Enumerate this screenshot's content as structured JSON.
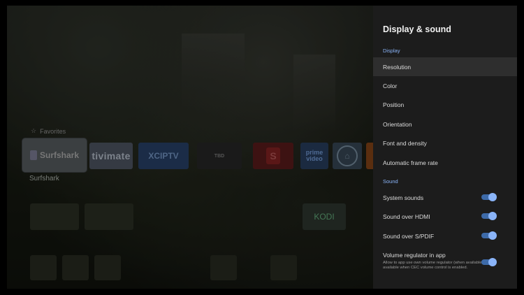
{
  "home": {
    "favorites_label": "Favorites",
    "apps": [
      {
        "name": "Surfshark"
      },
      {
        "name": "tivimate"
      },
      {
        "name": "XCIPTV"
      },
      {
        "name": "TBD"
      },
      {
        "name": "S"
      },
      {
        "name": "prime video"
      },
      {
        "name": "home"
      },
      {
        "name": ""
      }
    ],
    "focused_app_caption": "Surfshark",
    "kodi_label": "KODI"
  },
  "panel": {
    "title": "Display & sound",
    "sections": [
      {
        "header": "Display",
        "items": [
          {
            "label": "Resolution",
            "selected": true
          },
          {
            "label": "Color"
          },
          {
            "label": "Position"
          },
          {
            "label": "Orientation"
          },
          {
            "label": "Font and density"
          },
          {
            "label": "Automatic frame rate"
          }
        ]
      },
      {
        "header": "Sound",
        "items": [
          {
            "label": "System sounds",
            "toggle": true,
            "on": true
          },
          {
            "label": "Sound over HDMI",
            "toggle": true,
            "on": true
          },
          {
            "label": "Sound over S/PDIF",
            "toggle": true,
            "on": true
          },
          {
            "label": "Volume regulator in app",
            "description": "Allow to app use own volume regulator (when available). Not available when CEC volume control is enabled.",
            "toggle": true,
            "on": true
          }
        ]
      }
    ]
  },
  "colors": {
    "accent": "#8ab4f8",
    "panel_bg": "#1c1c1c",
    "selected_bg": "#2e2e2e"
  }
}
